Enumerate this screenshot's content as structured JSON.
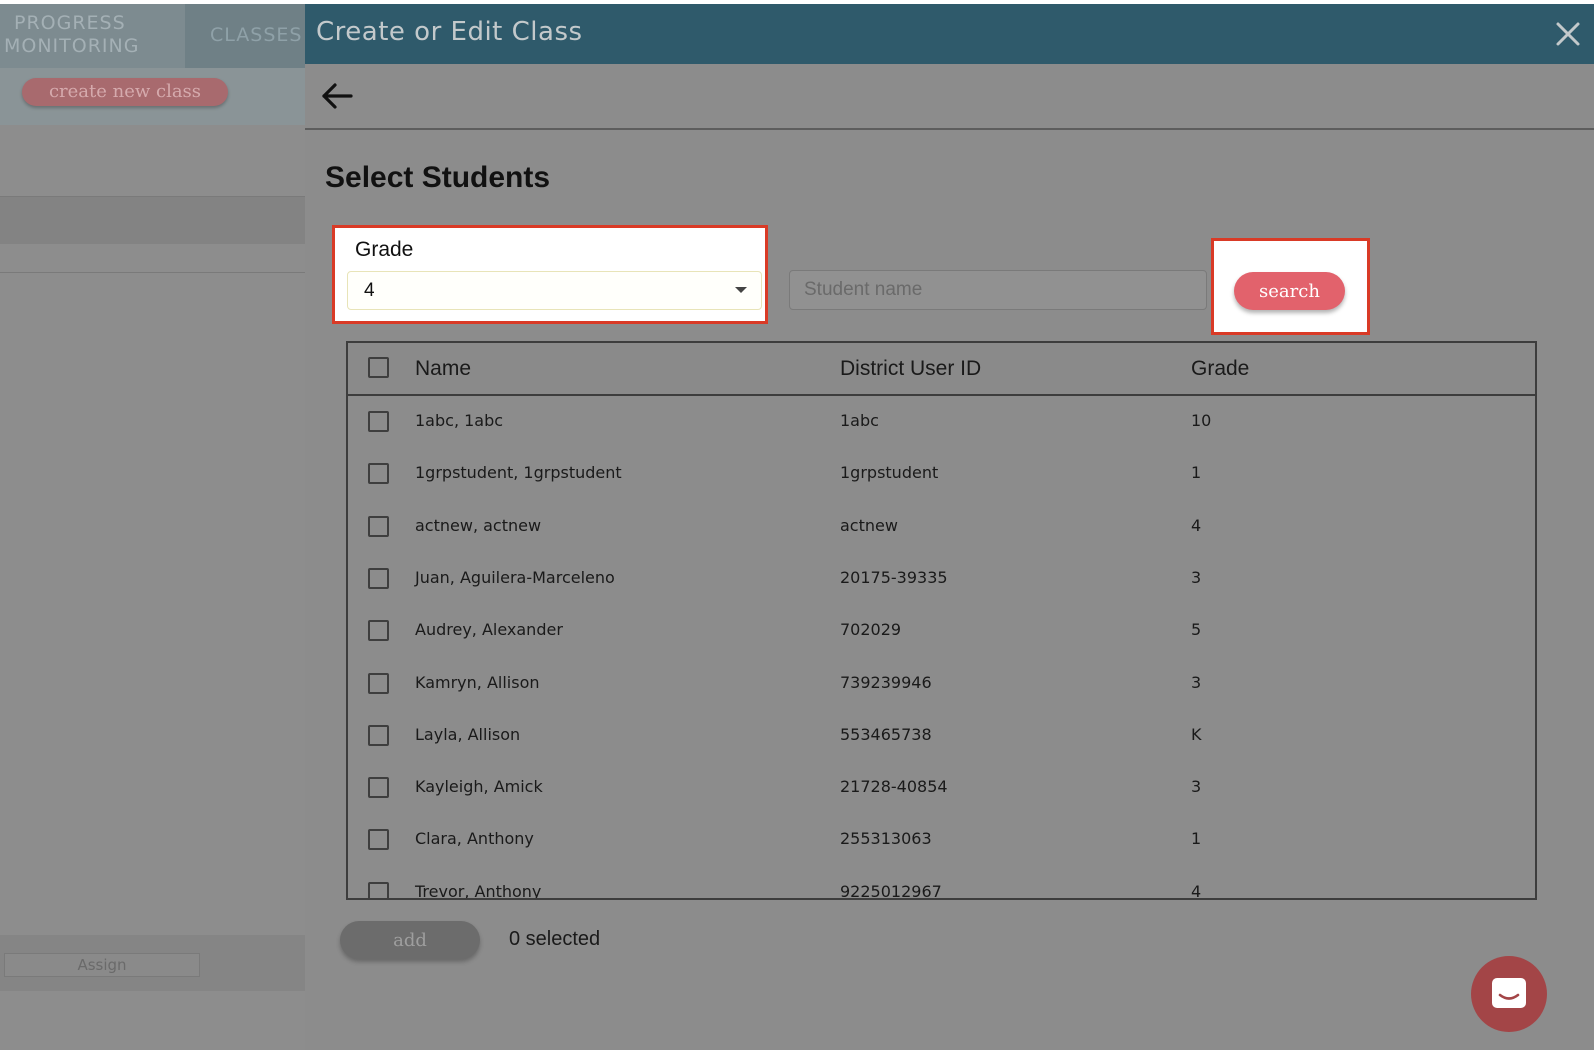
{
  "background": {
    "nav": {
      "progress_monitoring_line1": "PROGRESS",
      "progress_monitoring_line2": "MONITORING",
      "classes": "CLASSES"
    },
    "create_new_class_label": "create new class",
    "assign_label": "Assign"
  },
  "modal": {
    "title": "Create or Edit Class",
    "close_icon": "close-icon",
    "back_icon": "arrow-left-icon",
    "section_title": "Select Students",
    "grade_filter": {
      "label": "Grade",
      "value": "4"
    },
    "search": {
      "placeholder": "Student name",
      "value": "",
      "button_label": "search"
    },
    "table": {
      "columns": [
        "Name",
        "District User ID",
        "Grade"
      ],
      "rows": [
        {
          "name": "1abc, 1abc",
          "district_id": "1abc",
          "grade": "10"
        },
        {
          "name": "1grpstudent, 1grpstudent",
          "district_id": "1grpstudent",
          "grade": "1"
        },
        {
          "name": "actnew, actnew",
          "district_id": "actnew",
          "grade": "4"
        },
        {
          "name": "Juan, Aguilera-Marceleno",
          "district_id": "20175-39335",
          "grade": "3"
        },
        {
          "name": "Audrey, Alexander",
          "district_id": "702029",
          "grade": "5"
        },
        {
          "name": "Kamryn, Allison",
          "district_id": "739239946",
          "grade": "3"
        },
        {
          "name": "Layla, Allison",
          "district_id": "553465738",
          "grade": "K"
        },
        {
          "name": "Kayleigh, Amick",
          "district_id": "21728-40854",
          "grade": "3"
        },
        {
          "name": "Clara, Anthony",
          "district_id": "255313063",
          "grade": "1"
        },
        {
          "name": "Trevor, Anthony",
          "district_id": "9225012967",
          "grade": "4"
        }
      ]
    },
    "footer": {
      "add_label": "add",
      "selected_text": "0 selected"
    },
    "chat_icon": "chat-bubble-icon"
  },
  "colors": {
    "header": "#2f5a6b",
    "highlight": "#d93a26",
    "search_button": "#e2626c",
    "chat_button": "#a34547"
  }
}
